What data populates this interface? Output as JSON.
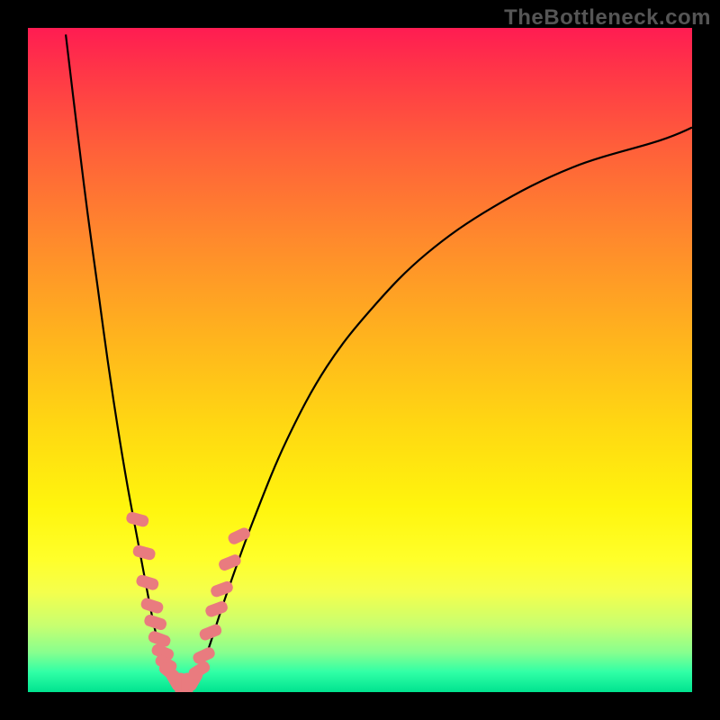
{
  "brand": "TheBottleneck.com",
  "chart_data": {
    "type": "line",
    "title": "",
    "xlabel": "",
    "ylabel": "",
    "xlim": [
      0,
      100
    ],
    "ylim": [
      0,
      100
    ],
    "grid": false,
    "background_gradient": {
      "direction": "vertical",
      "stops": [
        {
          "pos": 0.0,
          "color": "#ff1c52"
        },
        {
          "pos": 0.5,
          "color": "#ffd812"
        },
        {
          "pos": 0.8,
          "color": "#ffff2a"
        },
        {
          "pos": 1.0,
          "color": "#00e38f"
        }
      ]
    },
    "series": [
      {
        "name": "curve-left",
        "x": [
          5.7,
          7.5,
          9.0,
          10.5,
          12.0,
          13.5,
          15.0,
          16.5,
          18.0,
          19.0,
          20.0,
          21.0,
          22.0
        ],
        "values": [
          99.0,
          84.0,
          72.0,
          61.0,
          50.0,
          40.0,
          31.0,
          23.0,
          15.0,
          10.0,
          6.0,
          3.0,
          1.0
        ]
      },
      {
        "name": "curve-right",
        "x": [
          25.0,
          27.0,
          30.0,
          34.0,
          39.0,
          45.0,
          52.0,
          60.0,
          70.0,
          82.0,
          95.0,
          100.0
        ],
        "values": [
          1.0,
          6.0,
          15.0,
          26.0,
          38.0,
          49.0,
          58.0,
          66.0,
          73.0,
          79.0,
          83.0,
          85.0
        ]
      }
    ],
    "markers": {
      "name": "highlighted-points",
      "color": "#e97b7f",
      "shape": "rounded-rect",
      "points": [
        {
          "x": 16.5,
          "y": 26.0,
          "angle": -75
        },
        {
          "x": 17.5,
          "y": 21.0,
          "angle": -75
        },
        {
          "x": 18.0,
          "y": 16.5,
          "angle": -73
        },
        {
          "x": 18.7,
          "y": 13.0,
          "angle": -72
        },
        {
          "x": 19.2,
          "y": 10.5,
          "angle": -72
        },
        {
          "x": 19.8,
          "y": 8.0,
          "angle": -70
        },
        {
          "x": 20.3,
          "y": 6.0,
          "angle": -68
        },
        {
          "x": 20.8,
          "y": 4.3,
          "angle": -60
        },
        {
          "x": 21.3,
          "y": 3.0,
          "angle": -50
        },
        {
          "x": 22.1,
          "y": 1.8,
          "angle": -30
        },
        {
          "x": 23.0,
          "y": 1.2,
          "angle": 0
        },
        {
          "x": 24.0,
          "y": 1.2,
          "angle": 0
        },
        {
          "x": 25.0,
          "y": 1.8,
          "angle": 30
        },
        {
          "x": 25.8,
          "y": 3.3,
          "angle": 58
        },
        {
          "x": 26.5,
          "y": 5.5,
          "angle": 65
        },
        {
          "x": 27.5,
          "y": 9.0,
          "angle": 68
        },
        {
          "x": 28.4,
          "y": 12.5,
          "angle": 70
        },
        {
          "x": 29.2,
          "y": 15.5,
          "angle": 70
        },
        {
          "x": 30.4,
          "y": 19.5,
          "angle": 68
        },
        {
          "x": 31.8,
          "y": 23.5,
          "angle": 65
        }
      ]
    }
  }
}
